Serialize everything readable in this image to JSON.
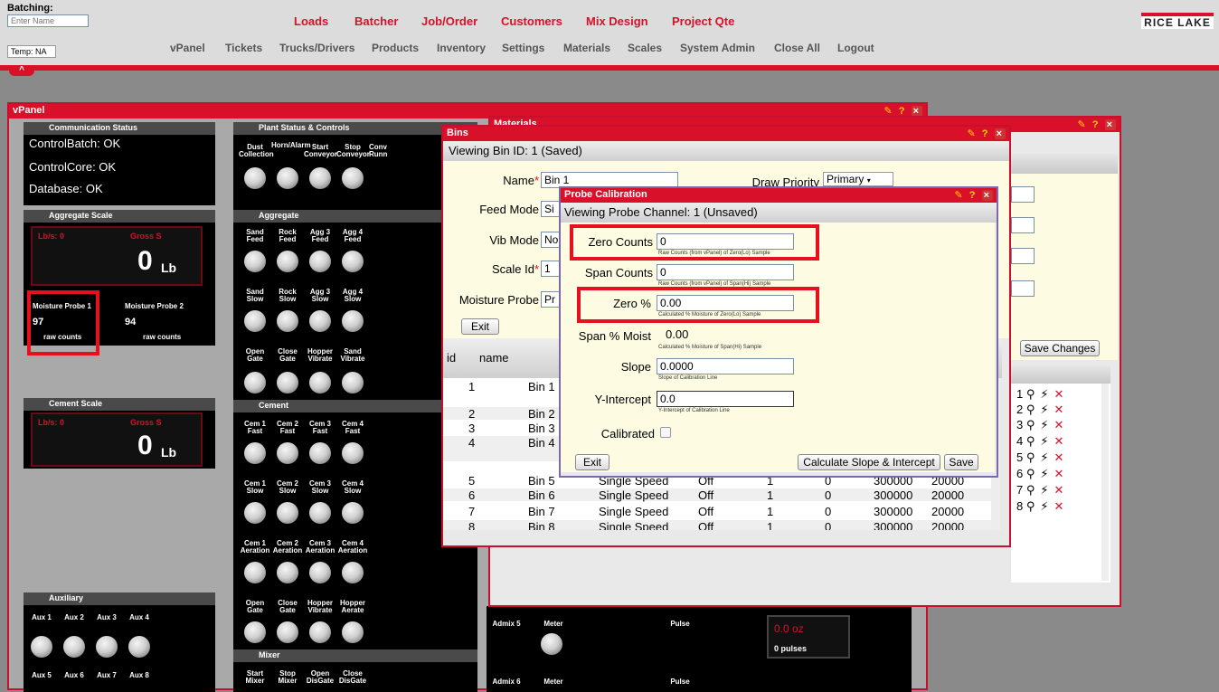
{
  "header": {
    "batching_label": "Batching:",
    "name_placeholder": "Enter Name",
    "temp": "Temp: NA",
    "brand": "RICE LAKE"
  },
  "top_nav": [
    "Loads",
    "Batcher",
    "Job/Order",
    "Customers",
    "Mix Design",
    "Project Qte"
  ],
  "main_nav": [
    "vPanel",
    "Tickets",
    "Trucks/Drivers",
    "Products",
    "Inventory",
    "Settings",
    "Materials",
    "Scales",
    "System Admin",
    "Close All",
    "Logout"
  ],
  "collapse_icon": "^",
  "vpanel": {
    "title": "vPanel",
    "comm": {
      "title": "Communication Status",
      "lines": [
        "ControlBatch: OK",
        "ControlCore: OK",
        "Database: OK"
      ]
    },
    "agg_scale": {
      "title": "Aggregate Scale",
      "lbs": "Lb/s: 0",
      "gross": "Gross S",
      "value": "0",
      "unit": "Lb"
    },
    "probe1": {
      "title": "Moisture Probe 1",
      "value": "97",
      "unit": "raw counts"
    },
    "probe2": {
      "title": "Moisture Probe 2",
      "value": "94",
      "unit": "raw counts"
    },
    "cement_scale": {
      "title": "Cement Scale",
      "lbs": "Lb/s: 0",
      "gross": "Gross S",
      "value": "0",
      "unit": "Lb"
    },
    "aux": {
      "title": "Auxiliary",
      "row1": [
        "Aux 1",
        "Aux 2",
        "Aux 3",
        "Aux 4"
      ],
      "row2": [
        "Aux 5",
        "Aux 6",
        "Aux 7",
        "Aux 8"
      ]
    },
    "plant": {
      "title": "Plant Status & Controls",
      "labels": [
        "Dust Collection",
        "Horn/Alarm",
        "Start Conveyor",
        "Stop Conveyor",
        "Conv Runn"
      ]
    },
    "aggregate": {
      "title": "Aggregate",
      "row1": [
        "Sand Feed",
        "Rock Feed",
        "Agg 3 Feed",
        "Agg 4 Feed"
      ],
      "row2": [
        "Sand Slow",
        "Rock Slow",
        "Agg 3 Slow",
        "Agg 4 Slow"
      ],
      "row3": [
        "Open Gate",
        "Close Gate",
        "Hopper Vibrate",
        "Sand Vibrate"
      ]
    },
    "cement": {
      "title": "Cement",
      "row1": [
        "Cem 1 Fast",
        "Cem 2 Fast",
        "Cem 3 Fast",
        "Cem 4 Fast"
      ],
      "row2": [
        "Cem 1 Slow",
        "Cem 2 Slow",
        "Cem 3 Slow",
        "Cem 4 Slow"
      ],
      "row3": [
        "Cem 1 Aeration",
        "Cem 2 Aeration",
        "Cem 3 Aeration",
        "Cem 4 Aeration"
      ],
      "row4": [
        "Open Gate",
        "Close Gate",
        "Hopper Vibrate",
        "Hopper Aerate"
      ]
    },
    "mixer": {
      "title": "Mixer",
      "labels": [
        "Start Mixer",
        "Stop Mixer",
        "Open DisGate",
        "Close DisGate"
      ]
    },
    "admix5": {
      "name": "Admix 5",
      "meter": "Meter",
      "pulse": "Pulse",
      "oz": "0.0 oz",
      "pulses": "0 pulses"
    },
    "admix6": {
      "name": "Admix 6",
      "meter": "Meter",
      "pulse": "Pulse"
    }
  },
  "materials": {
    "title": "Materials",
    "save": "Save Changes",
    "rows": [
      {
        "id": "1"
      },
      {
        "id": "2"
      },
      {
        "id": "3"
      },
      {
        "id": "4"
      },
      {
        "id": "5"
      },
      {
        "id": "6"
      },
      {
        "id": "7"
      },
      {
        "id": "8"
      }
    ]
  },
  "bins": {
    "title": "Bins",
    "subtitle": "Viewing Bin ID: 1 (Saved)",
    "name_label": "Name",
    "name_value": "Bin 1",
    "draw_priority_label": "Draw Priority",
    "draw_priority_value": "Primary",
    "feed_mode_label": "Feed Mode",
    "feed_mode_value": "Si",
    "vib_mode_label": "Vib Mode",
    "vib_mode_value": "No",
    "scale_id_label": "Scale Id",
    "scale_id_value": "1",
    "moisture_probe_label": "Moisture Probe",
    "moisture_probe_value": "Pr",
    "exit": "Exit",
    "col_id": "id",
    "col_name": "name",
    "rows": [
      {
        "id": "1",
        "name": "Bin 1",
        "mode": "",
        "vib": "",
        "a": "",
        "b": "",
        "c": "",
        "d": ""
      },
      {
        "id": "2",
        "name": "Bin 2",
        "mode": "",
        "vib": "",
        "a": "",
        "b": "",
        "c": "",
        "d": ""
      },
      {
        "id": "3",
        "name": "Bin 3",
        "mode": "",
        "vib": "",
        "a": "",
        "b": "",
        "c": "",
        "d": ""
      },
      {
        "id": "4",
        "name": "Bin 4",
        "mode": "",
        "vib": "",
        "a": "",
        "b": "",
        "c": "",
        "d": ""
      },
      {
        "id": "5",
        "name": "Bin 5",
        "mode": "Single Speed",
        "vib": "Off",
        "a": "1",
        "b": "0",
        "c": "300000",
        "d": "20000"
      },
      {
        "id": "6",
        "name": "Bin 6",
        "mode": "Single Speed",
        "vib": "Off",
        "a": "1",
        "b": "0",
        "c": "300000",
        "d": "20000"
      },
      {
        "id": "7",
        "name": "Bin 7",
        "mode": "Single Speed",
        "vib": "Off",
        "a": "1",
        "b": "0",
        "c": "300000",
        "d": "20000"
      },
      {
        "id": "8",
        "name": "Bin 8",
        "mode": "Single Speed",
        "vib": "Off",
        "a": "1",
        "b": "0",
        "c": "300000",
        "d": "20000"
      }
    ]
  },
  "probe": {
    "title": "Probe Calibration",
    "subtitle": "Viewing Probe Channel: 1 (Unsaved)",
    "zero_counts_label": "Zero Counts",
    "zero_counts": "0",
    "zero_counts_hint": "Raw Counts (from vPanel) of Zero(Lo) Sample",
    "span_counts_label": "Span Counts",
    "span_counts": "0",
    "span_counts_hint": "Raw Counts (from vPanel) of Span(Hi) Sample",
    "zero_pct_label": "Zero %",
    "zero_pct": "0.00",
    "zero_pct_hint": "Calculated % Moisture of Zero(Lo) Sample",
    "span_pct_label": "Span % Moist",
    "span_pct": "0.00",
    "span_pct_hint": "Calculated % Moisture of Span(Hi) Sample",
    "slope_label": "Slope",
    "slope": "0.0000",
    "slope_hint": "Slope of Calibration Line",
    "yint_label": "Y-Intercept",
    "yint": "0.0",
    "yint_hint": "Y-Intercept of Calibration Line",
    "calibrated_label": "Calibrated",
    "exit": "Exit",
    "calc": "Calculate Slope & Intercept",
    "save": "Save"
  },
  "colors": {
    "accent": "#d8102a",
    "highlight": "#e8101e",
    "panel_bg": "#000000",
    "cream": "#fdfbe2"
  }
}
